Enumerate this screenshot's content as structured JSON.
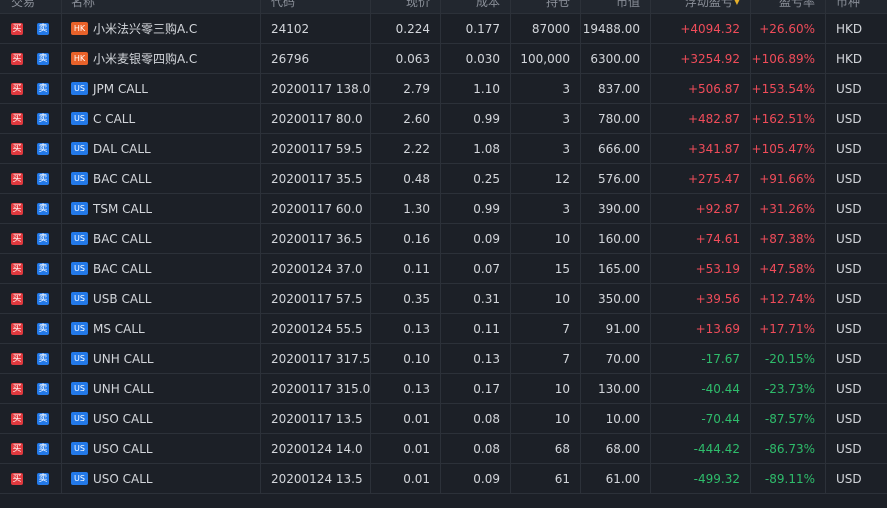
{
  "header": {
    "trade": "交易",
    "name": "名称",
    "code": "代码",
    "price": "现价",
    "cost": "成本",
    "qty": "持仓",
    "market_value": "市值",
    "pnl": "浮动盈亏",
    "pnl_ratio": "盈亏率",
    "currency": "币种"
  },
  "buttons": {
    "buy": "买",
    "sell": "卖"
  },
  "colors": {
    "up": "#f04c5a",
    "down": "#2ebc6b",
    "buy": "#e0393e",
    "sell": "#2379e8",
    "hk_badge": "#e8622a",
    "us_badge": "#2379e8"
  },
  "rows": [
    {
      "market": "HK",
      "name": "小米法兴零三购A.C",
      "code": "24102",
      "price": "0.224",
      "cost": "0.177",
      "qty": "87000",
      "market_value": "19488.00",
      "pnl": "+4094.32",
      "pnl_ratio": "+26.60%",
      "currency": "HKD"
    },
    {
      "market": "HK",
      "name": "小米麦银零四购A.C",
      "code": "26796",
      "price": "0.063",
      "cost": "0.030",
      "qty": "100,000",
      "market_value": "6300.00",
      "pnl": "+3254.92",
      "pnl_ratio": "+106.89%",
      "currency": "HKD"
    },
    {
      "market": "US",
      "name": "JPM CALL",
      "code": "20200117 138.0",
      "price": "2.79",
      "cost": "1.10",
      "qty": "3",
      "market_value": "837.00",
      "pnl": "+506.87",
      "pnl_ratio": "+153.54%",
      "currency": "USD"
    },
    {
      "market": "US",
      "name": "C CALL",
      "code": "20200117 80.0",
      "price": "2.60",
      "cost": "0.99",
      "qty": "3",
      "market_value": "780.00",
      "pnl": "+482.87",
      "pnl_ratio": "+162.51%",
      "currency": "USD"
    },
    {
      "market": "US",
      "name": "DAL CALL",
      "code": "20200117 59.5",
      "price": "2.22",
      "cost": "1.08",
      "qty": "3",
      "market_value": "666.00",
      "pnl": "+341.87",
      "pnl_ratio": "+105.47%",
      "currency": "USD"
    },
    {
      "market": "US",
      "name": "BAC CALL",
      "code": "20200117 35.5",
      "price": "0.48",
      "cost": "0.25",
      "qty": "12",
      "market_value": "576.00",
      "pnl": "+275.47",
      "pnl_ratio": "+91.66%",
      "currency": "USD"
    },
    {
      "market": "US",
      "name": "TSM CALL",
      "code": "20200117 60.0",
      "price": "1.30",
      "cost": "0.99",
      "qty": "3",
      "market_value": "390.00",
      "pnl": "+92.87",
      "pnl_ratio": "+31.26%",
      "currency": "USD"
    },
    {
      "market": "US",
      "name": "BAC CALL",
      "code": "20200117 36.5",
      "price": "0.16",
      "cost": "0.09",
      "qty": "10",
      "market_value": "160.00",
      "pnl": "+74.61",
      "pnl_ratio": "+87.38%",
      "currency": "USD"
    },
    {
      "market": "US",
      "name": "BAC CALL",
      "code": "20200124 37.0",
      "price": "0.11",
      "cost": "0.07",
      "qty": "15",
      "market_value": "165.00",
      "pnl": "+53.19",
      "pnl_ratio": "+47.58%",
      "currency": "USD"
    },
    {
      "market": "US",
      "name": "USB CALL",
      "code": "20200117 57.5",
      "price": "0.35",
      "cost": "0.31",
      "qty": "10",
      "market_value": "350.00",
      "pnl": "+39.56",
      "pnl_ratio": "+12.74%",
      "currency": "USD"
    },
    {
      "market": "US",
      "name": "MS CALL",
      "code": "20200124 55.5",
      "price": "0.13",
      "cost": "0.11",
      "qty": "7",
      "market_value": "91.00",
      "pnl": "+13.69",
      "pnl_ratio": "+17.71%",
      "currency": "USD"
    },
    {
      "market": "US",
      "name": "UNH CALL",
      "code": "20200117 317.5",
      "price": "0.10",
      "cost": "0.13",
      "qty": "7",
      "market_value": "70.00",
      "pnl": "-17.67",
      "pnl_ratio": "-20.15%",
      "currency": "USD"
    },
    {
      "market": "US",
      "name": "UNH CALL",
      "code": "20200117 315.0",
      "price": "0.13",
      "cost": "0.17",
      "qty": "10",
      "market_value": "130.00",
      "pnl": "-40.44",
      "pnl_ratio": "-23.73%",
      "currency": "USD"
    },
    {
      "market": "US",
      "name": "USO CALL",
      "code": "20200117 13.5",
      "price": "0.01",
      "cost": "0.08",
      "qty": "10",
      "market_value": "10.00",
      "pnl": "-70.44",
      "pnl_ratio": "-87.57%",
      "currency": "USD"
    },
    {
      "market": "US",
      "name": "USO CALL",
      "code": "20200124 14.0",
      "price": "0.01",
      "cost": "0.08",
      "qty": "68",
      "market_value": "68.00",
      "pnl": "-444.42",
      "pnl_ratio": "-86.73%",
      "currency": "USD"
    },
    {
      "market": "US",
      "name": "USO CALL",
      "code": "20200124 13.5",
      "price": "0.01",
      "cost": "0.09",
      "qty": "61",
      "market_value": "61.00",
      "pnl": "-499.32",
      "pnl_ratio": "-89.11%",
      "currency": "USD"
    }
  ]
}
